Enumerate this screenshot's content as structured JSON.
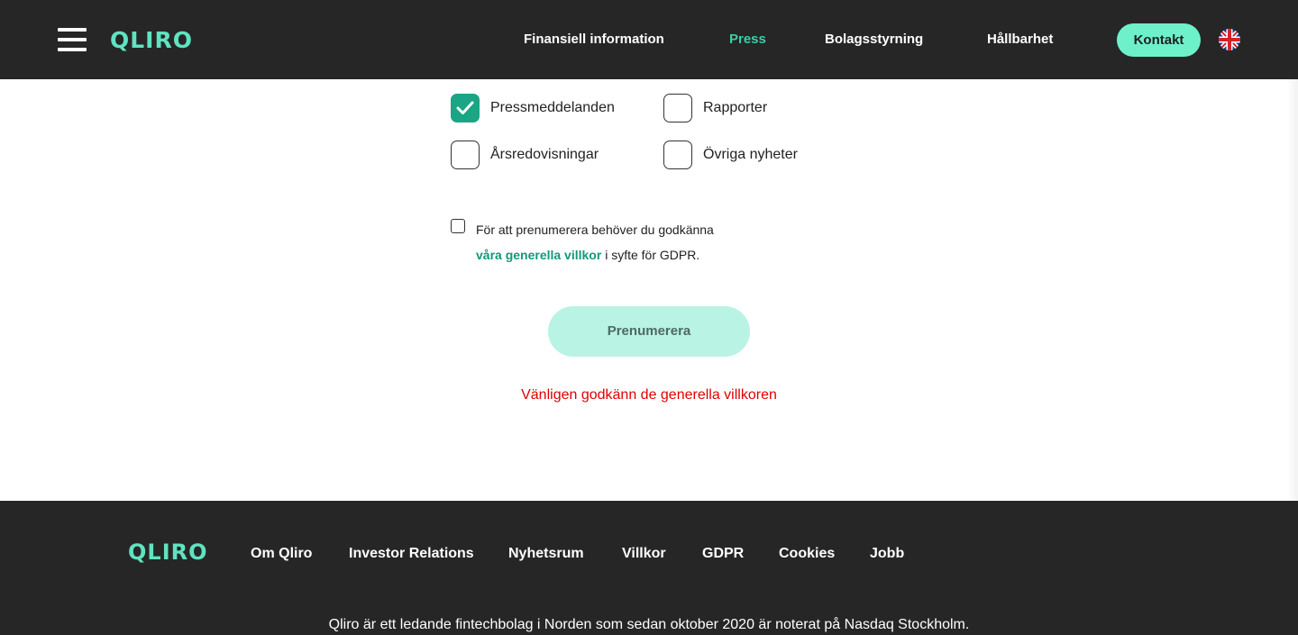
{
  "header": {
    "logo": "QLIRO",
    "nav": [
      {
        "label": "Finansiell information"
      },
      {
        "label": "Press"
      },
      {
        "label": "Bolagsstyrning"
      },
      {
        "label": "Hållbarhet"
      }
    ],
    "contact_label": "Kontakt",
    "language_icon": "uk-flag-icon"
  },
  "form": {
    "categories": [
      {
        "label": "Pressmeddelanden",
        "checked": true
      },
      {
        "label": "Rapporter",
        "checked": false
      },
      {
        "label": "Årsredovisningar",
        "checked": false
      },
      {
        "label": "Övriga nyheter",
        "checked": false
      }
    ],
    "gdpr": {
      "checked": false,
      "text_before": "För att prenumerera behöver du godkänna",
      "link_text": "våra generella villkor",
      "text_after": " i syfte för GDPR."
    },
    "subscribe_label": "Prenumerera",
    "error_message": "Vänligen godkänn de generella villkoren"
  },
  "footer": {
    "logo": "QLIRO",
    "links": [
      {
        "label": "Om Qliro"
      },
      {
        "label": "Investor Relations"
      },
      {
        "label": "Nyhetsrum"
      },
      {
        "label": "Villkor"
      },
      {
        "label": "GDPR"
      },
      {
        "label": "Cookies"
      },
      {
        "label": "Jobb"
      }
    ],
    "description": "Qliro är ett ledande fintechbolag i Norden som sedan oktober 2020 är noterat på Nasdaq Stockholm."
  },
  "colors": {
    "header_bg": "#262626",
    "brand": "#5fe3c0",
    "active_nav": "#3ccfa4",
    "checkbox_checked": "#1aa584",
    "error": "#e00000"
  }
}
